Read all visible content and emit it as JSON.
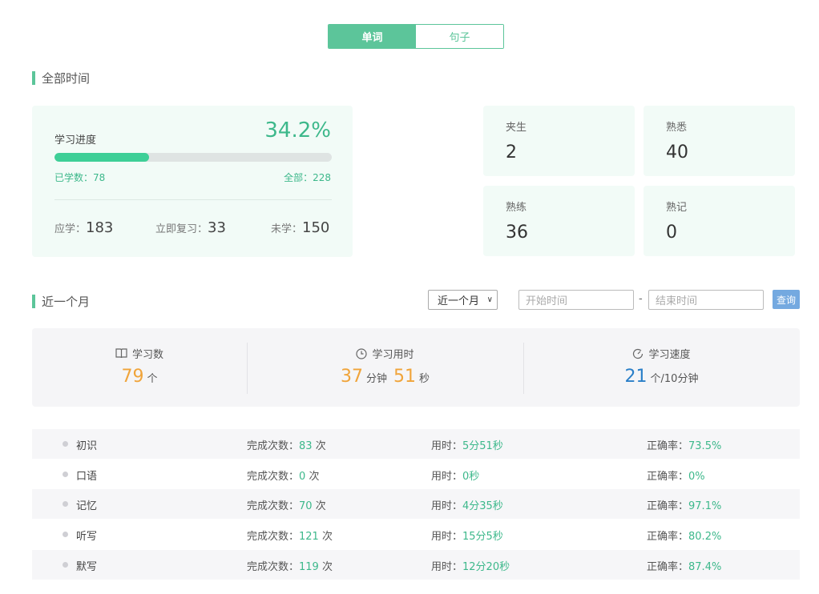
{
  "tabs": [
    {
      "label": "单词",
      "active": true
    },
    {
      "label": "句子",
      "active": false
    }
  ],
  "all_time": {
    "title": "全部时间",
    "progress": {
      "label": "学习进度",
      "percent_text": "34.2%",
      "fraction": 0.342,
      "learned_label": "已学数：",
      "learned": "78",
      "total_label": "全部：",
      "total": "228",
      "should_label": "应学：",
      "should": "183",
      "review_label": "立即复习：",
      "review": "33",
      "unlearned_label": "未学：",
      "unlearned": "150"
    },
    "levels": [
      {
        "label": "夹生",
        "value": "2"
      },
      {
        "label": "熟悉",
        "value": "40"
      },
      {
        "label": "熟练",
        "value": "36"
      },
      {
        "label": "熟记",
        "value": "0"
      }
    ]
  },
  "recent": {
    "title": "近一个月",
    "range_select": "近一个月",
    "start_placeholder": "开始时间",
    "end_placeholder": "结束时间",
    "dash": "-",
    "query_label": "查询",
    "summary": {
      "count": {
        "label": "学习数",
        "value": "79",
        "unit": "个"
      },
      "time": {
        "label": "学习用时",
        "minutes": "37",
        "minutes_unit": "分钟",
        "seconds": "51",
        "seconds_unit": "秒"
      },
      "speed": {
        "label": "学习速度",
        "value": "21",
        "unit": "个/10分钟"
      }
    },
    "rows": [
      {
        "name": "初识",
        "done_label": "完成次数：",
        "done": "83",
        "done_unit": "次",
        "time_label": "用时：",
        "time": "5分51秒",
        "acc_label": "正确率：",
        "acc": "73.5%"
      },
      {
        "name": "口语",
        "done_label": "完成次数：",
        "done": "0",
        "done_unit": "次",
        "time_label": "用时：",
        "time": "0秒",
        "acc_label": "正确率：",
        "acc": "0%"
      },
      {
        "name": "记忆",
        "done_label": "完成次数：",
        "done": "70",
        "done_unit": "次",
        "time_label": "用时：",
        "time": "4分35秒",
        "acc_label": "正确率：",
        "acc": "97.1%"
      },
      {
        "name": "听写",
        "done_label": "完成次数：",
        "done": "121",
        "done_unit": "次",
        "time_label": "用时：",
        "time": "15分5秒",
        "acc_label": "正确率：",
        "acc": "80.2%"
      },
      {
        "name": "默写",
        "done_label": "完成次数：",
        "done": "119",
        "done_unit": "次",
        "time_label": "用时：",
        "time": "12分20秒",
        "acc_label": "正确率：",
        "acc": "87.4%"
      }
    ]
  },
  "colors": {
    "accent": "#5cc59a",
    "orange": "#f0a43a",
    "blue": "#2a7fc8",
    "query": "#74a9e0"
  }
}
